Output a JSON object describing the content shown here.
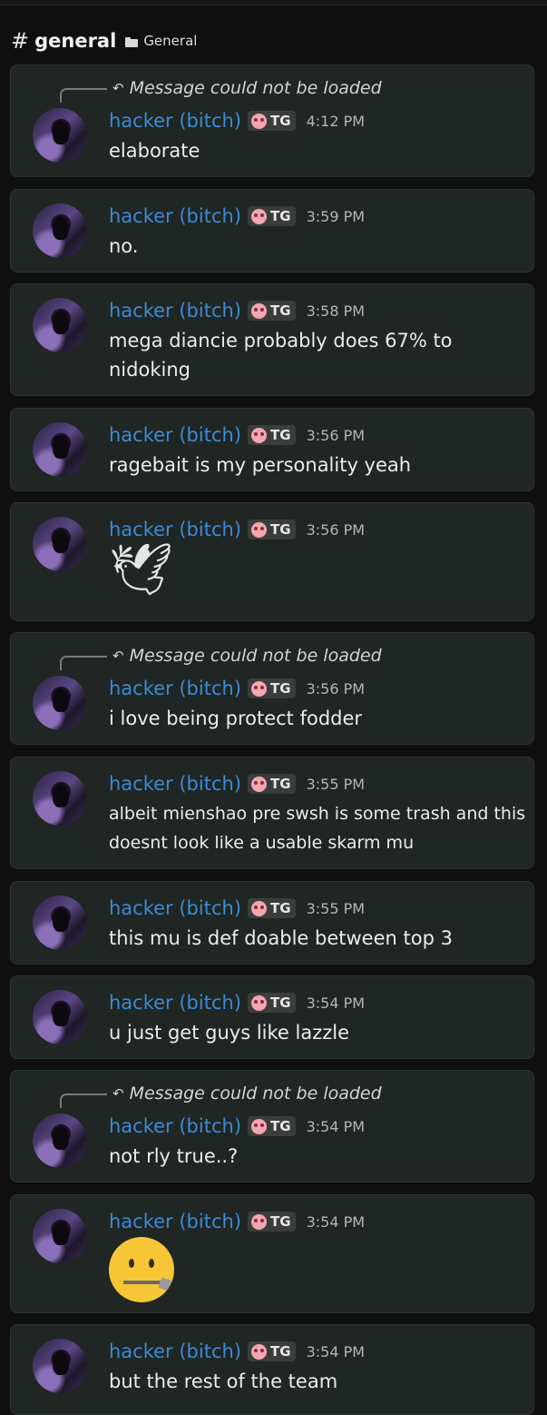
{
  "channel": {
    "name": "general",
    "category": "General"
  },
  "reply_text": "Message could not be loaded",
  "user": {
    "name": "hacker (bitch)",
    "tag": "TG"
  },
  "messages": [
    {
      "time": "4:12 PM",
      "text": "elaborate",
      "reply": true
    },
    {
      "time": "3:59 PM",
      "text": "no."
    },
    {
      "time": "3:58 PM",
      "text": "mega diancie probably does 67% to nidoking"
    },
    {
      "time": "3:56 PM",
      "text": "ragebait is my personality yeah"
    },
    {
      "time": "3:56 PM",
      "emoji": "dove-icon"
    },
    {
      "time": "3:56 PM",
      "text": "i love being protect fodder",
      "reply": true
    },
    {
      "time": "3:55 PM",
      "text": "albeit mienshao pre swsh is some trash and this doesnt look like a usable skarm mu"
    },
    {
      "time": "3:55 PM",
      "text": "this mu is def doable between top 3"
    },
    {
      "time": "3:54 PM",
      "text": "u just get guys like lazzle"
    },
    {
      "time": "3:54 PM",
      "text": "not rly true..?",
      "reply": true
    },
    {
      "time": "3:54 PM",
      "emoji": "zipper-mouth-face-icon"
    },
    {
      "time": "3:54 PM",
      "text": "but the rest of the team"
    }
  ]
}
